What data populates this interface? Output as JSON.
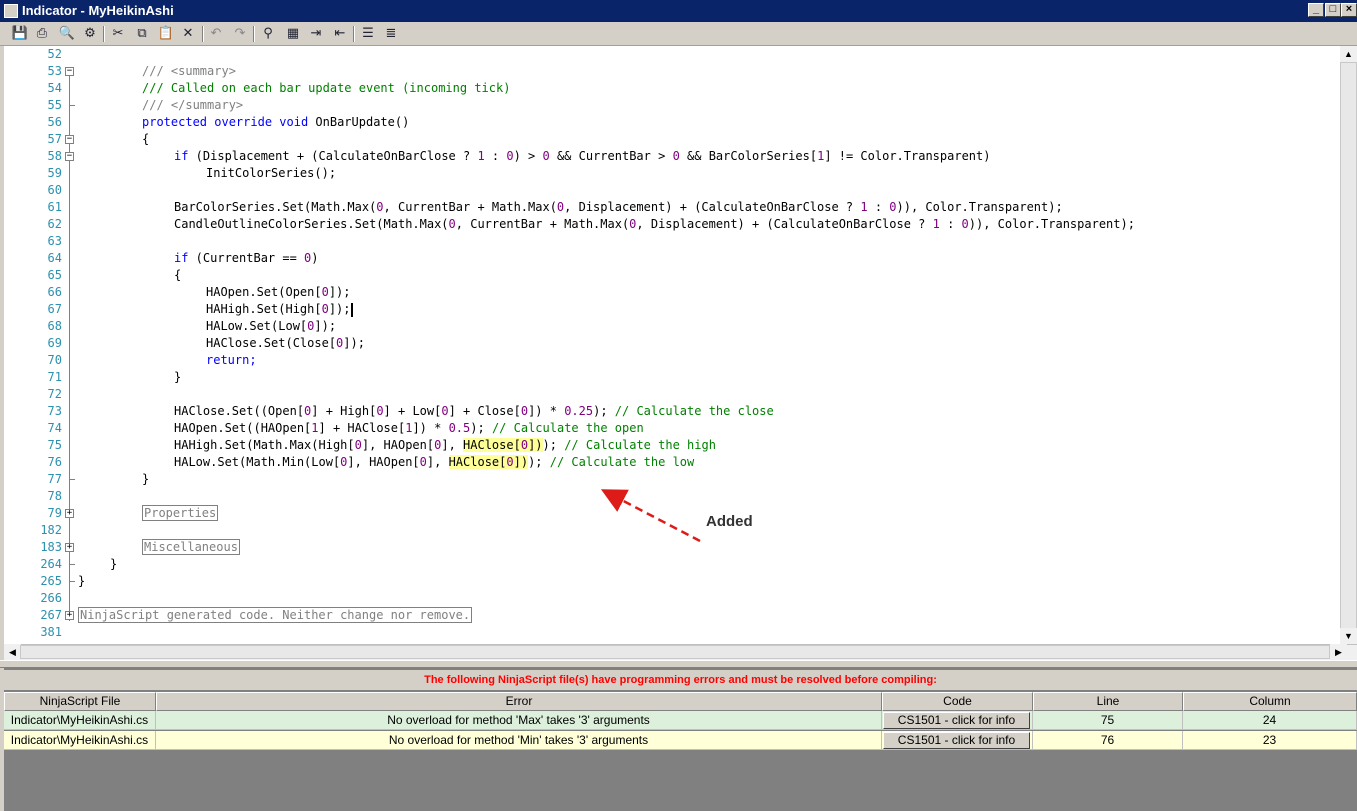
{
  "window": {
    "title": "Indicator - MyHeikinAshi"
  },
  "toolbar": {
    "icons": [
      "save-icon",
      "print-icon",
      "print-preview-icon",
      "compile-icon",
      "cut-icon",
      "copy-icon",
      "paste-icon",
      "delete-icon",
      "undo-icon",
      "redo-icon",
      "find-icon",
      "replace-icon",
      "indent-icon",
      "outdent-icon",
      "comment-icon",
      "uncomment-icon"
    ]
  },
  "editor": {
    "line_numbers": [
      "52",
      "53",
      "54",
      "55",
      "56",
      "57",
      "58",
      "59",
      "60",
      "61",
      "62",
      "63",
      "64",
      "65",
      "66",
      "67",
      "68",
      "69",
      "70",
      "71",
      "72",
      "73",
      "74",
      "75",
      "76",
      "77",
      "78",
      "79",
      "182",
      "183",
      "264",
      "265",
      "266",
      "267",
      "381"
    ],
    "lines": {
      "l53": "/// <summary>",
      "l54": "/// Called on each bar update event (incoming tick)",
      "l55": "/// </summary>",
      "l56_kw": "protected override void",
      "l56_rest": " OnBarUpdate()",
      "l57": "{",
      "l58_kw": "if",
      "l58_a": " (Displacement + (CalculateOnBarClose ? ",
      "l58_n1": "1",
      "l58_b": " : ",
      "l58_n2": "0",
      "l58_c": ") > ",
      "l58_n3": "0",
      "l58_d": " && CurrentBar > ",
      "l58_n4": "0",
      "l58_e": " && BarColorSeries[",
      "l58_n5": "1",
      "l58_f": "] != Color.Transparent)",
      "l59": "InitColorSeries();",
      "l61_a": "BarColorSeries.Set(Math.Max(",
      "l61_n1": "0",
      "l61_b": ", CurrentBar + Math.Max(",
      "l61_n2": "0",
      "l61_c": ", Displacement) + (CalculateOnBarClose ? ",
      "l61_n3": "1",
      "l61_d": " : ",
      "l61_n4": "0",
      "l61_e": ")), Color.Transparent);",
      "l62_a": "CandleOutlineColorSeries.Set(Math.Max(",
      "l62_n1": "0",
      "l62_b": ", CurrentBar + Math.Max(",
      "l62_n2": "0",
      "l62_c": ", Displacement) + (CalculateOnBarClose ? ",
      "l62_n3": "1",
      "l62_d": " : ",
      "l62_n4": "0",
      "l62_e": ")), Color.Transparent);",
      "l64_kw": "if",
      "l64_a": " (CurrentBar == ",
      "l64_n": "0",
      "l64_b": ")",
      "l65": "{",
      "l66_a": "HAOpen.Set(Open[",
      "l66_n": "0",
      "l66_b": "]);",
      "l67_a": "HAHigh.Set(High[",
      "l67_n": "0",
      "l67_b": "]);",
      "l68_a": "HALow.Set(Low[",
      "l68_n": "0",
      "l68_b": "]);",
      "l69_a": "HAClose.Set(Close[",
      "l69_n": "0",
      "l69_b": "]);",
      "l70": "return;",
      "l71": "}",
      "l73_a": "HAClose.Set((Open[",
      "l73_n1": "0",
      "l73_b": "] + High[",
      "l73_n2": "0",
      "l73_c": "] + Low[",
      "l73_n3": "0",
      "l73_d": "] + Close[",
      "l73_n4": "0",
      "l73_e": "]) * ",
      "l73_n5": "0.25",
      "l73_f": "); ",
      "l73_cm": "// Calculate the close",
      "l74_a": "HAOpen.Set((HAOpen[",
      "l74_n1": "1",
      "l74_b": "] + HAClose[",
      "l74_n2": "1",
      "l74_c": "]) * ",
      "l74_n3": "0.5",
      "l74_d": "); ",
      "l74_cm": "// Calculate the open",
      "l75_a": "HAHigh.Set(Math.Max(High[",
      "l75_n1": "0",
      "l75_b": "], HAOpen[",
      "l75_n2": "0",
      "l75_c": "], ",
      "l75_hl_a": "HAClose[",
      "l75_hl_n": "0",
      "l75_hl_b": "])",
      "l75_d": "); ",
      "l75_cm": "// Calculate the high",
      "l76_a": "HALow.Set(Math.Min(Low[",
      "l76_n1": "0",
      "l76_b": "], HAOpen[",
      "l76_n2": "0",
      "l76_c": "], ",
      "l76_hl_a": "HAClose[",
      "l76_hl_n": "0",
      "l76_hl_b": "])",
      "l76_d": "); ",
      "l76_cm": "// Calculate the low",
      "l77": "}",
      "l79": "Properties",
      "l183": "Miscellaneous",
      "l264": "}",
      "l265": "}",
      "l267": "NinjaScript generated code. Neither change nor remove."
    }
  },
  "annotation": {
    "label": "Added",
    "color": "#dd1c1a"
  },
  "errors": {
    "message": "The following NinjaScript file(s) have programming errors and must be resolved before compiling:",
    "columns": [
      "NinjaScript File",
      "Error",
      "Code",
      "Line",
      "Column"
    ],
    "rows": [
      {
        "file": "Indicator\\MyHeikinAshi.cs",
        "error": "No overload for method 'Max' takes '3' arguments",
        "code": "CS1501 - click for info",
        "line": "75",
        "column": "24",
        "bg": "#dcf0dc"
      },
      {
        "file": "Indicator\\MyHeikinAshi.cs",
        "error": "No overload for method 'Min' takes '3' arguments",
        "code": "CS1501 - click for info",
        "line": "76",
        "column": "23",
        "bg": "#ffffd8"
      }
    ]
  }
}
